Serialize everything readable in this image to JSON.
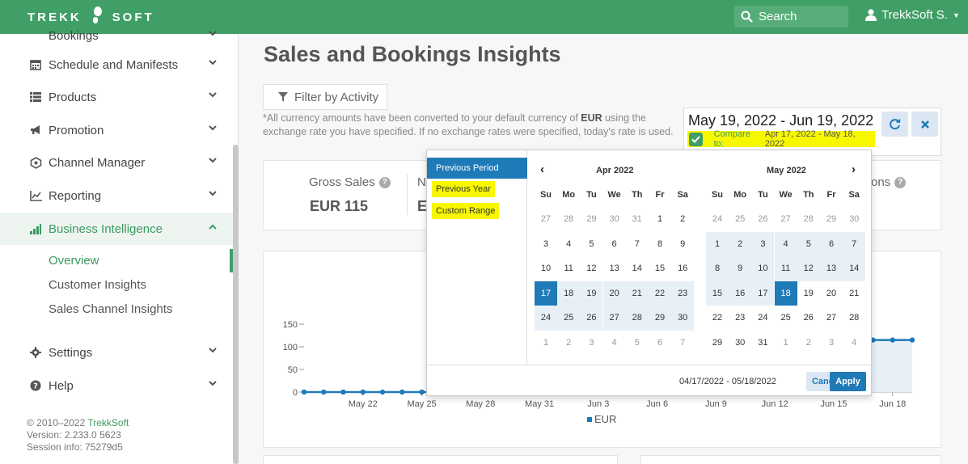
{
  "app": {
    "logo_left": "TREKK",
    "logo_right": "SOFT",
    "search_label": "Search",
    "user_name": "TrekkSoft S."
  },
  "sidebar": {
    "items": [
      {
        "label": "Bookings",
        "icon": "bookings-icon"
      },
      {
        "label": "Schedule and Manifests",
        "icon": "calendar-icon"
      },
      {
        "label": "Products",
        "icon": "list-icon"
      },
      {
        "label": "Promotion",
        "icon": "bullhorn-icon"
      },
      {
        "label": "Channel Manager",
        "icon": "network-icon"
      },
      {
        "label": "Reporting",
        "icon": "line-chart-icon"
      },
      {
        "label": "Business Intelligence",
        "icon": "bar-chart-icon",
        "active": true
      },
      {
        "label": "Settings",
        "icon": "gear-icon"
      },
      {
        "label": "Help",
        "icon": "question-circle-icon"
      }
    ],
    "subitems": [
      {
        "label": "Overview",
        "active": true
      },
      {
        "label": "Customer Insights"
      },
      {
        "label": "Sales Channel Insights"
      }
    ],
    "footer": {
      "copyright_prefix": "© 2010–2022",
      "copyright_link": "TrekkSoft",
      "version": "Version: 2.233.0 5623",
      "session": "Session info: 75279d5"
    }
  },
  "main": {
    "title": "Sales and Bookings Insights",
    "filter_label": "Filter by Activity",
    "note_part1": "*All currency amounts have been converted to your default currency of ",
    "note_currency": "EUR",
    "note_part2": " using the exchange rate you have specified. If no exchange rates were specified, today's rate is used.",
    "date_range": "May 19, 2022 - Jun 19, 2022",
    "compare_label": "Compare to:",
    "compare_dates": "Apr 17, 2022 - May 18, 2022",
    "stats": [
      {
        "label": "Gross Sales",
        "value": "EUR 115"
      },
      {
        "label": "N",
        "value": "E"
      },
      {
        "label": "ons",
        "value": ""
      }
    ]
  },
  "datepicker": {
    "ranges": [
      "Previous Period",
      "Previous Year",
      "Custom Range"
    ],
    "weekdays": [
      "Su",
      "Mo",
      "Tu",
      "We",
      "Th",
      "Fr",
      "Sa"
    ],
    "left_month": "Apr 2022",
    "right_month": "May 2022",
    "left_days": [
      [
        "27",
        "28",
        "29",
        "30",
        "31",
        "1",
        "2"
      ],
      [
        "3",
        "4",
        "5",
        "6",
        "7",
        "8",
        "9"
      ],
      [
        "10",
        "11",
        "12",
        "13",
        "14",
        "15",
        "16"
      ],
      [
        "17",
        "18",
        "19",
        "20",
        "21",
        "22",
        "23"
      ],
      [
        "24",
        "25",
        "26",
        "27",
        "28",
        "29",
        "30"
      ],
      [
        "1",
        "2",
        "3",
        "4",
        "5",
        "6",
        "7"
      ]
    ],
    "right_days": [
      [
        "24",
        "25",
        "26",
        "27",
        "28",
        "29",
        "30"
      ],
      [
        "1",
        "2",
        "3",
        "4",
        "5",
        "6",
        "7"
      ],
      [
        "8",
        "9",
        "10",
        "11",
        "12",
        "13",
        "14"
      ],
      [
        "15",
        "16",
        "17",
        "18",
        "19",
        "20",
        "21"
      ],
      [
        "22",
        "23",
        "24",
        "25",
        "26",
        "27",
        "28"
      ],
      [
        "29",
        "30",
        "31",
        "1",
        "2",
        "3",
        "4"
      ]
    ],
    "footer_range": "04/17/2022 - 05/18/2022",
    "cancel_label": "Cancel",
    "apply_label": "Apply",
    "colors": {
      "selected": "#1f7ab8",
      "highlight": "#f7f700",
      "in_range": "#e8f0f7"
    }
  },
  "chart_data": {
    "type": "line",
    "title": "",
    "xlabel": "",
    "ylabel": "",
    "y_ticks": [
      "150",
      "100",
      "50",
      "0"
    ],
    "ylim": [
      0,
      150
    ],
    "x_ticks": [
      "May 22",
      "May 25",
      "May 28",
      "May 31",
      "Jun 3",
      "Jun 6",
      "Jun 9",
      "Jun 12",
      "Jun 15",
      "Jun 18"
    ],
    "series": [
      {
        "name": "EUR",
        "color": "#1f7ab8",
        "x_visible_start": [
          "May 19",
          "May 20",
          "May 21",
          "May 22",
          "May 23",
          "May 24",
          "May 25",
          "May 26"
        ],
        "values_visible_start": [
          0,
          0,
          0,
          0,
          0,
          0,
          0,
          0
        ],
        "x_visible_end": [
          "Jun 17",
          "Jun 18",
          "Jun 19"
        ],
        "values_visible_end": [
          115,
          115,
          115
        ]
      }
    ],
    "legend": "bottom"
  }
}
